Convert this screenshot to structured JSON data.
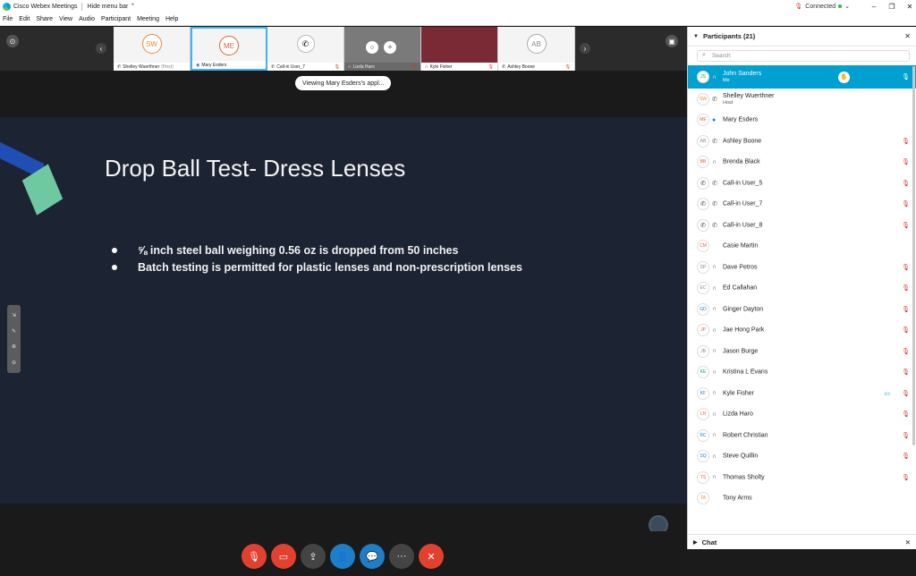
{
  "titlebar": {
    "app_title": "Cisco Webex Meetings",
    "hide_menu": "Hide menu bar",
    "hide_menu_chev": "⌃",
    "status": "Connected",
    "minimize": "–",
    "restore": "❐",
    "close": "✕"
  },
  "menu": [
    "File",
    "Edit",
    "Share",
    "View",
    "Audio",
    "Participant",
    "Meeting",
    "Help"
  ],
  "filmstrip": {
    "tiles": [
      {
        "initials": "SW",
        "name": "Shelley Wuerthner",
        "suffix": "(Host)",
        "color": "#e8883a"
      },
      {
        "initials": "ME",
        "name": "Mary Esders",
        "suffix": "",
        "color": "#e0613a"
      },
      {
        "initials": "",
        "name": "Call-in User_7",
        "suffix": "",
        "color": "#444"
      },
      {
        "initials": "",
        "name": "Lizda Haro",
        "suffix": "",
        "color": "#444"
      },
      {
        "initials": "",
        "name": "Kyle Fisher",
        "suffix": "",
        "color": "#444"
      },
      {
        "initials": "AB",
        "name": "Ashley Boone",
        "suffix": "",
        "color": "#888"
      }
    ]
  },
  "viewing_label": "Viewing Mary Esders's appl...",
  "slide": {
    "title": "Drop Ball Test- Dress Lenses",
    "bullets": [
      "⅝ inch steel ball weighing 0.56 oz is dropped from 50 inches",
      "Batch testing is permitted for plastic lenses and non-prescription lenses"
    ]
  },
  "controls": [
    {
      "name": "mute-button",
      "icon": "🎙",
      "color": "#e2412f"
    },
    {
      "name": "video-button",
      "icon": "▭",
      "color": "#e2412f"
    },
    {
      "name": "share-button",
      "icon": "⇪",
      "color": "#444"
    },
    {
      "name": "participants-button",
      "icon": "👤",
      "color": "#1e7ec8"
    },
    {
      "name": "chat-button",
      "icon": "💬",
      "color": "#1e7ec8"
    },
    {
      "name": "more-button",
      "icon": "···",
      "color": "#444"
    },
    {
      "name": "leave-button",
      "icon": "✕",
      "color": "#e2412f"
    }
  ],
  "panel": {
    "title": "Participants (21)",
    "search_placeholder": "Search",
    "close": "✕",
    "chat_label": "Chat",
    "participants": [
      {
        "initials": "JS",
        "name": "John Sanders",
        "sub": "Me",
        "audio": "headset",
        "muted": true,
        "me": true,
        "hand": true,
        "color": "#0a8"
      },
      {
        "initials": "SW",
        "name": "Shelley Wuerthner",
        "sub": "Host",
        "audio": "phone",
        "muted": false,
        "color": "#e8883a"
      },
      {
        "initials": "ME",
        "name": "Mary Esders",
        "sub": "",
        "audio": "share",
        "muted": false,
        "color": "#e0613a"
      },
      {
        "initials": "AB",
        "name": "Ashley Boone",
        "sub": "",
        "audio": "phone",
        "muted": true,
        "color": "#888"
      },
      {
        "initials": "BB",
        "name": "Brenda Black",
        "sub": "",
        "audio": "headset",
        "muted": true,
        "color": "#e0613a"
      },
      {
        "initials": "",
        "name": "Call-in User_5",
        "sub": "",
        "audio": "phone",
        "muted": true,
        "phone": true
      },
      {
        "initials": "",
        "name": "Call-in User_7",
        "sub": "",
        "audio": "phone",
        "muted": true,
        "phone": true
      },
      {
        "initials": "",
        "name": "Call-in User_8",
        "sub": "",
        "audio": "phone",
        "muted": true,
        "phone": true
      },
      {
        "initials": "CM",
        "name": "Casie Martin",
        "sub": "",
        "audio": "",
        "muted": false,
        "color": "#e0613a"
      },
      {
        "initials": "DP",
        "name": "Dave Petros",
        "sub": "",
        "audio": "headset",
        "muted": true,
        "color": "#888"
      },
      {
        "initials": "EC",
        "name": "Ed Callahan",
        "sub": "",
        "audio": "headset",
        "muted": true,
        "color": "#888"
      },
      {
        "initials": "GD",
        "name": "Ginger Dayton",
        "sub": "",
        "audio": "headset",
        "muted": true,
        "color": "#1e7ec8"
      },
      {
        "initials": "JP",
        "name": "Jae Hong Park",
        "sub": "",
        "audio": "headset",
        "muted": true,
        "color": "#e0613a"
      },
      {
        "initials": "JB",
        "name": "Jason Burge",
        "sub": "",
        "audio": "headset",
        "muted": true,
        "color": "#888"
      },
      {
        "initials": "KE",
        "name": "Kristina L Evans",
        "sub": "",
        "audio": "headset",
        "muted": true,
        "color": "#0a8"
      },
      {
        "initials": "KF",
        "name": "Kyle Fisher",
        "sub": "",
        "audio": "headset",
        "muted": true,
        "video": true,
        "color": "#1e7ec8"
      },
      {
        "initials": "LH",
        "name": "Lizda Haro",
        "sub": "",
        "audio": "headset",
        "muted": true,
        "color": "#e0613a"
      },
      {
        "initials": "RC",
        "name": "Robert Christian",
        "sub": "",
        "audio": "headset",
        "muted": true,
        "color": "#1e7ec8"
      },
      {
        "initials": "SQ",
        "name": "Steve Quillin",
        "sub": "",
        "audio": "headset",
        "muted": true,
        "color": "#1e7ec8"
      },
      {
        "initials": "TS",
        "name": "Thomas Sholty",
        "sub": "",
        "audio": "headset",
        "muted": true,
        "color": "#e0613a"
      },
      {
        "initials": "TA",
        "name": "Tony Arms",
        "sub": "",
        "audio": "",
        "muted": false,
        "color": "#e8883a"
      }
    ]
  },
  "colors": {
    "accent": "#00a0d1",
    "mute_red": "#d9342b",
    "slide_bg": "#1c2333"
  }
}
